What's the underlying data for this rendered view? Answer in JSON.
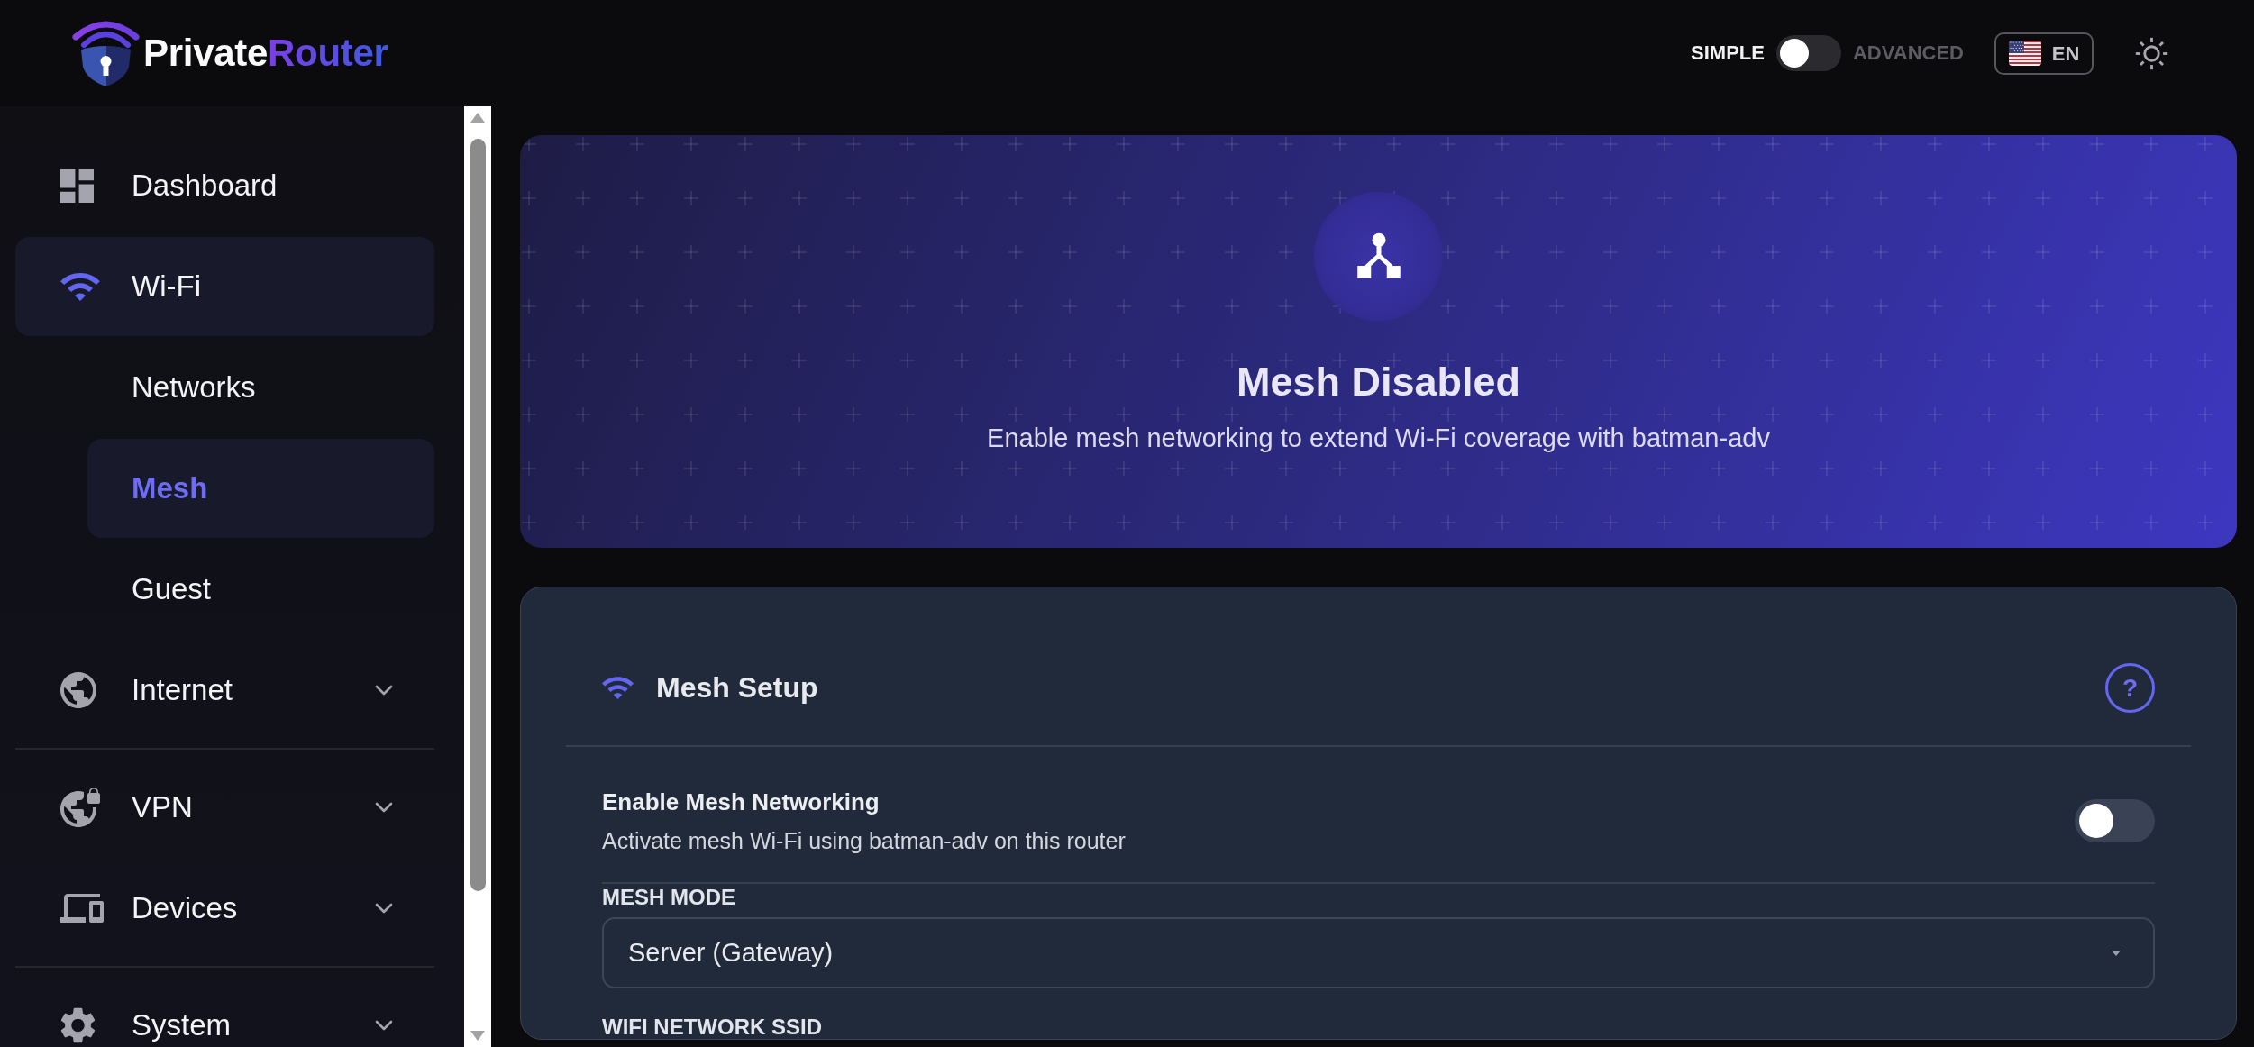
{
  "header": {
    "logo": {
      "text": "Private",
      "accent_text": "Router"
    },
    "mode_switch": {
      "simple_label": "SIMPLE",
      "advanced_label": "ADVANCED",
      "advanced": false
    },
    "language": {
      "label": "EN"
    }
  },
  "sidebar": {
    "sections": [
      {
        "items": [
          {
            "kind": "link",
            "label": "Dashboard",
            "selected": false
          },
          {
            "kind": "group",
            "label": "Wi-Fi",
            "selected": true,
            "expanded": true,
            "children": [
              {
                "label": "Networks",
                "selected": false
              },
              {
                "label": "Mesh",
                "selected": true
              },
              {
                "label": "Guest",
                "selected": false
              }
            ]
          },
          {
            "kind": "group",
            "label": "Internet",
            "selected": false,
            "expanded": false
          }
        ]
      },
      {
        "items": [
          {
            "kind": "group",
            "label": "VPN",
            "selected": false,
            "expanded": false
          },
          {
            "kind": "group",
            "label": "Devices",
            "selected": false,
            "expanded": false
          }
        ]
      },
      {
        "items": [
          {
            "kind": "group",
            "label": "System",
            "selected": false,
            "expanded": false
          }
        ]
      }
    ]
  },
  "hero": {
    "title": "Mesh Disabled",
    "subtitle": "Enable mesh networking to extend Wi-Fi coverage with batman-adv"
  },
  "mesh_setup": {
    "title": "Mesh Setup",
    "help": "?",
    "settings": [
      {
        "kind": "toggle",
        "label": "Enable Mesh Networking",
        "description": "Activate mesh Wi-Fi using batman-adv on this router",
        "on": false
      },
      {
        "kind": "select",
        "label": "MESH MODE",
        "value": "Server (Gateway)"
      },
      {
        "kind": "input",
        "label": "WIFI NETWORK SSID"
      }
    ]
  }
}
